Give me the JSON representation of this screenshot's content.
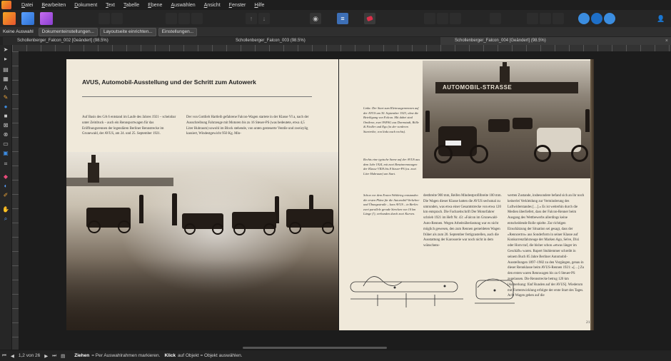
{
  "menu": [
    "Datei",
    "Bearbeiten",
    "Dokument",
    "Text",
    "Tabelle",
    "Ebene",
    "Auswählen",
    "Ansicht",
    "Fenster",
    "Hilfe"
  ],
  "icons": {
    "app": "affinity-publisher-icon",
    "persona_designer": "designer-persona-icon",
    "persona_photo": "photo-persona-icon"
  },
  "context": {
    "selection": "Keine Auswahl",
    "doc_settings": "Dokumenteinstellungen...",
    "layout_settings": "Layoutseite einrichten...",
    "settings": "Einstellungen..."
  },
  "tabs": [
    {
      "label": "Schollenberger_Falcon_002 [Geändert] (98.5%)"
    },
    {
      "label": "Schollenberger_Falcon_003 (98.5%)"
    },
    {
      "label": "Schollenberger_Falcon_004 [Geändert] (98.5%)"
    }
  ],
  "spread": {
    "title": "AVUS, Automobil-Ausstellung und der Schritt zum Autowerk",
    "left_col_1": "Auf Basis des GA 6 entstand im Laufe des Jahres 1921 – scheinbar unter Zeitdruck – auch ein Rennsportwagen für das Eröffnungsrennen der legendären Berliner Rennstrecke im Grunewald, der AVUS, am 24. und 25. September 1921.",
    "left_col_2": "Der von Gottlieb Hartleib gefahrene Falcon-Wagen startete in der Klasse VI a, nach der Ausschreibung Fahrzeuge mit Motoren bis zu 16 Steuer-PS (was bedeutete, etwa 4,5 Liter Hubraum) sowohl im Block stehende, von unten gesteuerte Ventile und zweizylig kassiert, Windestgewicht 950 Kg. Min-",
    "photo_right_sign": "AUTOMOBIL-STRASSE",
    "caption_1": "Links: Der Start zum Kleinwagenrennen auf der AVUS am 30. September 1923, ohne die Beteiligung von Falcon. Mit dabei sind Omikron, zwei FAFAG aus Darmstadt, Bölle & Fiedler und Ego (in der vorderen Startreihe, von links nach rechts).",
    "caption_2": "Rechts eine typische Szene auf der AVUS aus dem Jahr 1924, mit zwei Benzinrennwagen der Klasse VIIIA bis 8 Steuer-PS (ca. zwei Liter Hubraum) am Start.",
    "caption_3": "Schon vor dem Ersten Weltkrieg entstanden die ersten Pläne für die Automobil-Verkehrs- und Übungsstraße – kurz AVUS – in Berlin: zwei parallele gerade Strecken von 10 km Länge (!), verbunden durch zwei Kurven.",
    "right_col_1": "destbreite 900 mm, Reifen Mindestprofilbreite 100 mm. Die Wagen dieser Klasse hatten die AVUS sechsmal zu umrunden, was etwa einer Gesamtstrecke von etwa 120 km entsprach. Die Fachzeitschrift Der Motorfahrer schrieb 1921 im Heft Nr. 43: »Falcon im Grunewald-Auto-Rennen. Wegen Arbeitsüberlastung war es nicht möglich gewesen, den zum Rennen gemeldeten Wagen früher als zum 20. September fertigzustellen, auch die Ausstattung der Karosserie war noch nicht in dem wünschens-",
    "right_col_2": "werten Zustande, insbesondere befand sich an ihr noch keinerlei Verkleidung zur Verminderung des Luftwiderstandes […].« Es ist weiterhin durch die Medien überliefert, dass der Falcon-Renner beim Ausgang des Wettbewerbs allerdings keine entscheidende Rolle spielte. Zur richtigen Einschätzung der Situation sei gesagt, dass der »Renncertro« aus Sonderform in seiner Klasse auf Konkurrenzfahrzeuge der Marken Ago, Selve, Dixi oder Horn traf, die bisher schon »etwas länger im Geschäft« waren. Rupert Stuhlemmer schreibt in seinem Buch 85 Jahre Berliner Automobil-Ausstellungen 1897–1982 zu den Vorgängen, genau in dieser Rennklasse beim AVUS-Rennen 1921: »[…] Zu den ersten waren Rennwagen bis zu 6 Steuer-PS zugelassen. Die Rennstrecke betrug 120 km [Anmerkung: fünf Runden auf der AVUS]. Wiederum mit Fortentwicklung erfolgte der erste Start des Tages. Acht Wagen gehen auf die",
    "page_number": "21"
  },
  "status": {
    "page": "1,2 von 26",
    "hint_bold_1": "Ziehen",
    "hint_1": "= Per Auswahlrahmen markieren.",
    "hint_bold_2": "Klick",
    "hint_2": "auf Objekt = Objekt auswählen."
  },
  "colors": {
    "accent": "#3d6fb6",
    "page": "#f0e9da",
    "ui_bg": "#2b2b2b"
  }
}
